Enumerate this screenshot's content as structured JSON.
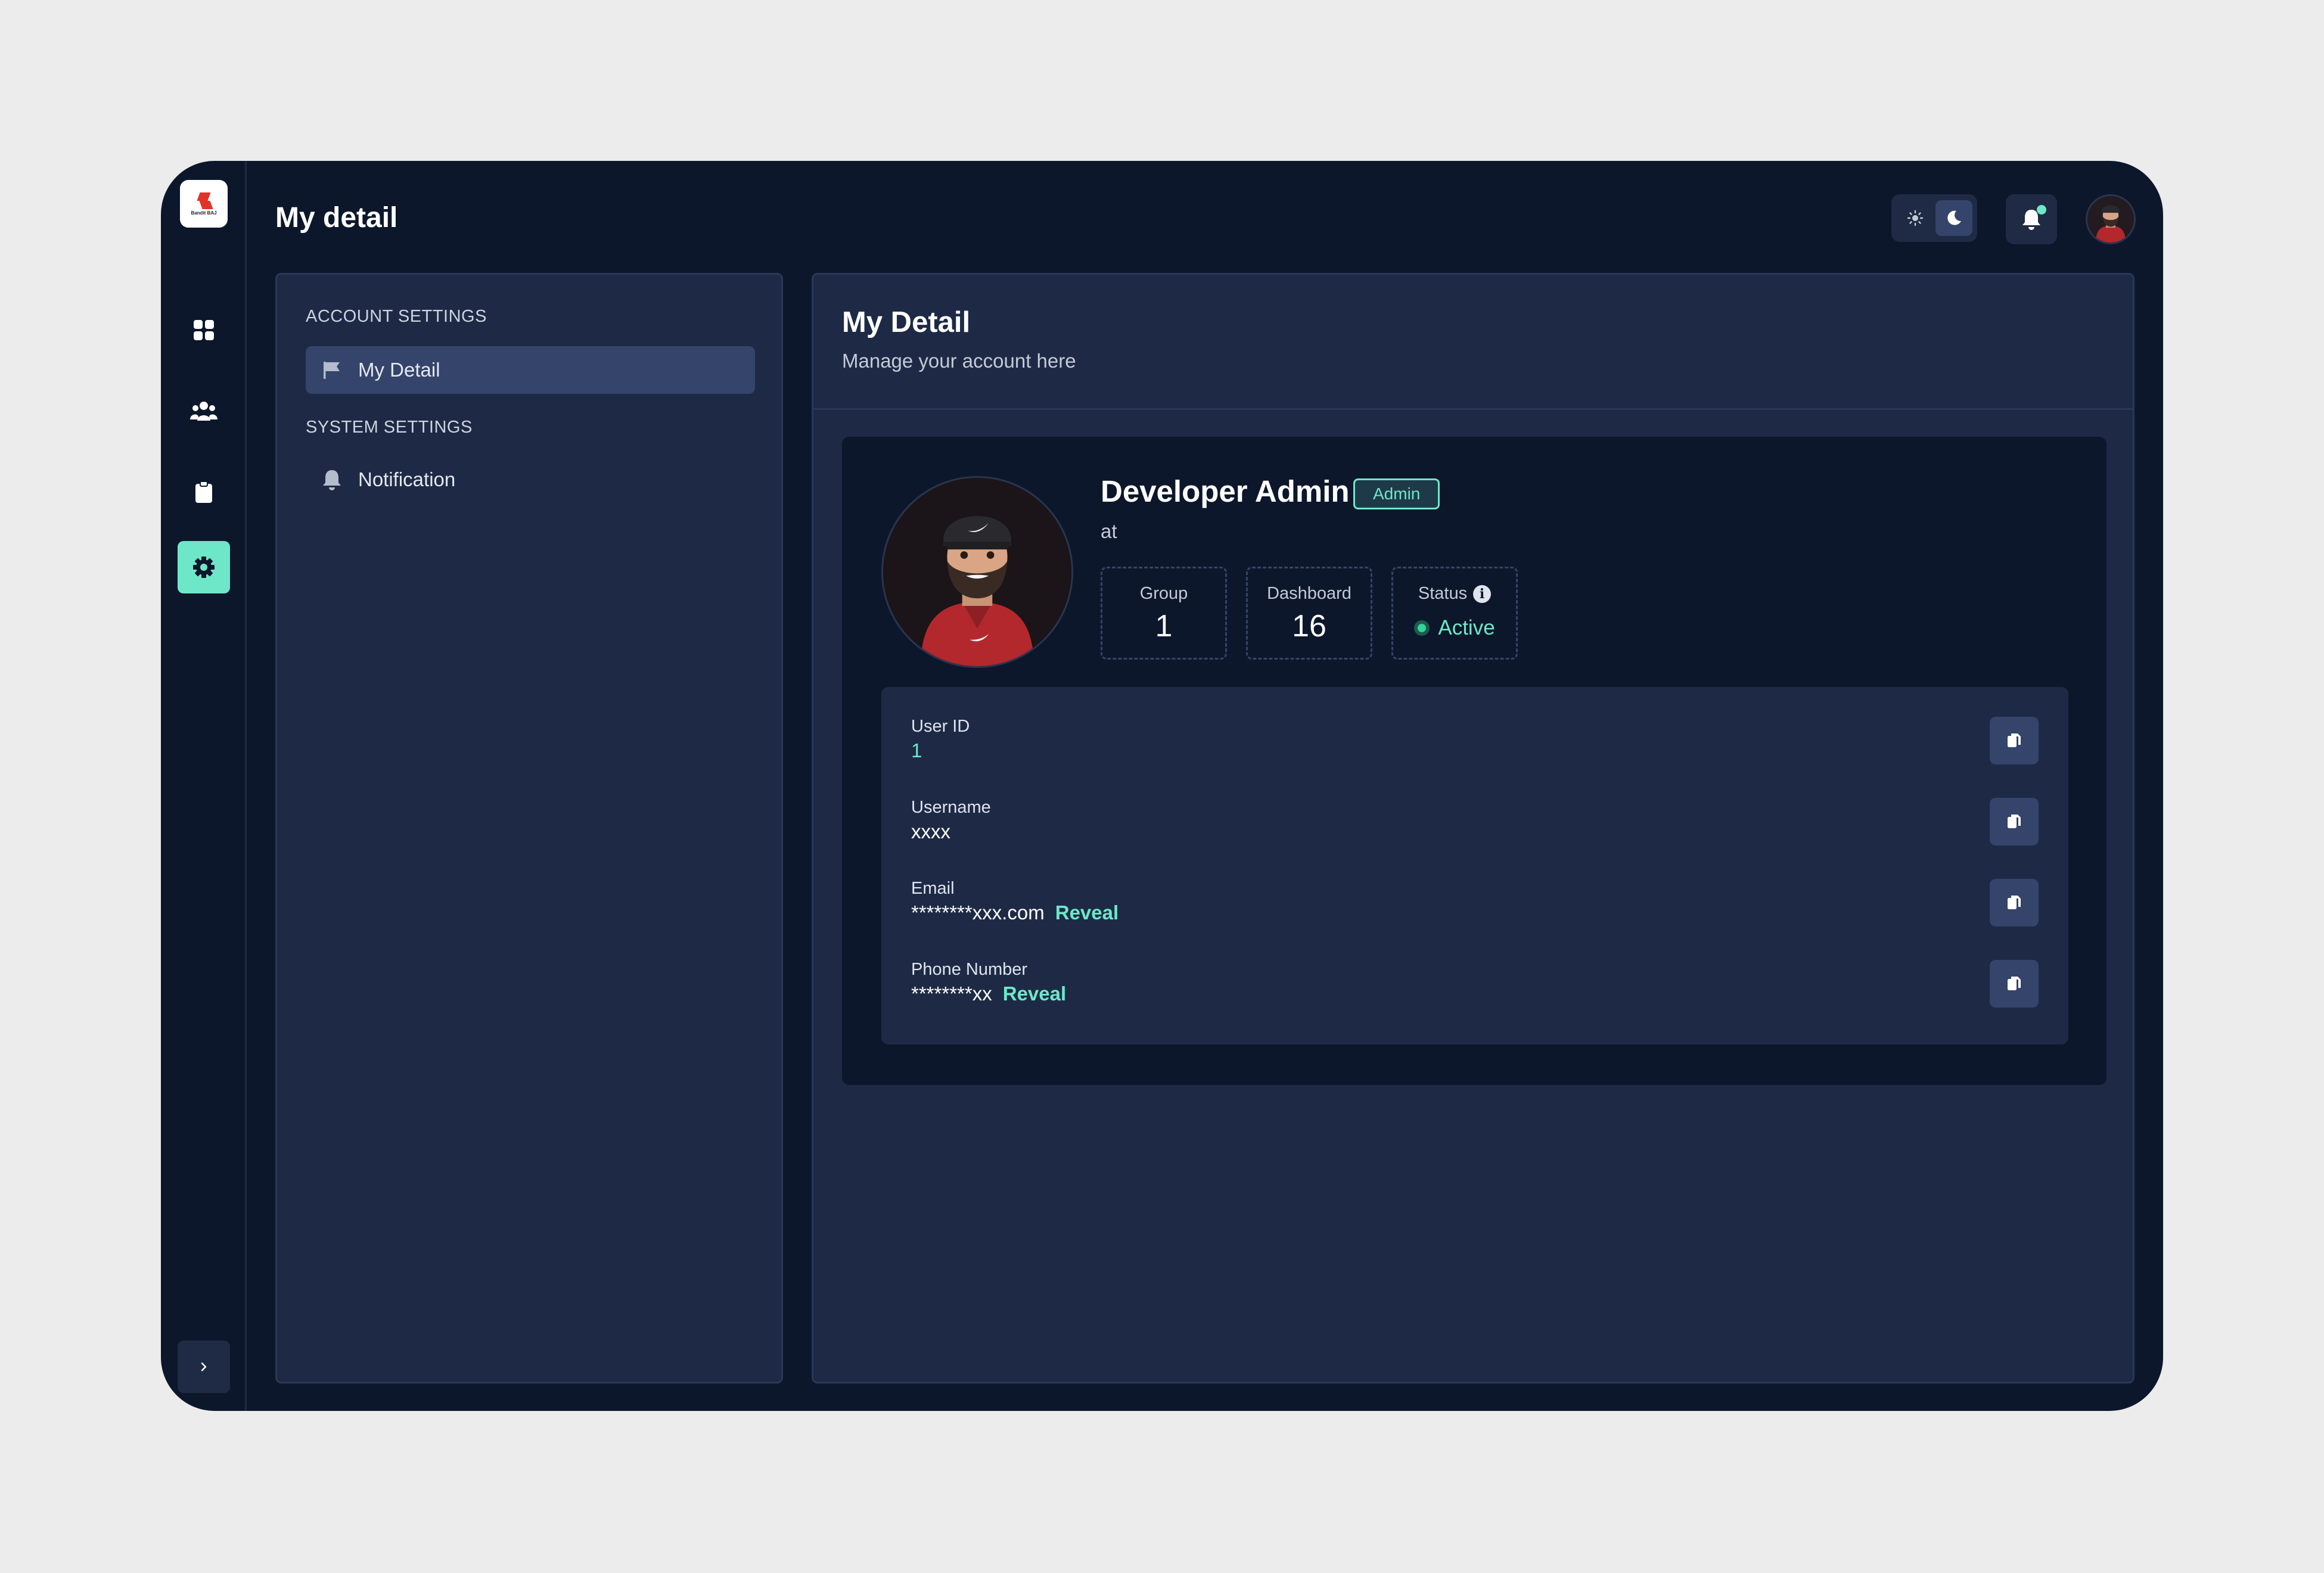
{
  "app": {
    "logo_text": "Bandit BAJ"
  },
  "header": {
    "title": "My detail"
  },
  "sidebar": {
    "items": [
      {
        "name": "dashboard",
        "icon": "grid-icon"
      },
      {
        "name": "users",
        "icon": "users-icon"
      },
      {
        "name": "reports",
        "icon": "clipboard-icon"
      },
      {
        "name": "settings",
        "icon": "gear-icon",
        "active": true
      }
    ]
  },
  "settings_menu": {
    "account_title": "ACCOUNT SETTINGS",
    "account_items": [
      {
        "label": "My Detail",
        "icon": "flag-icon",
        "active": true
      }
    ],
    "system_title": "SYSTEM SETTINGS",
    "system_items": [
      {
        "label": "Notification",
        "icon": "bell-icon"
      }
    ]
  },
  "main": {
    "title": "My Detail",
    "subtitle": "Manage your account here"
  },
  "profile": {
    "name": "Developer Admin",
    "role": "Admin",
    "org": "at",
    "stats": {
      "group_label": "Group",
      "group_value": "1",
      "dashboard_label": "Dashboard",
      "dashboard_value": "16",
      "status_label": "Status",
      "status_value": "Active"
    }
  },
  "fields": {
    "user_id_label": "User ID",
    "user_id_value": "1",
    "username_label": "Username",
    "username_value": "xxxx",
    "email_label": "Email",
    "email_value": "********xxx.com",
    "phone_label": "Phone Number",
    "phone_value": "********xx",
    "reveal_label": "Reveal"
  },
  "colors": {
    "background": "#ececec",
    "app_bg": "#0d172b",
    "panel_bg": "#1e2a45",
    "accent": "#6ee7c9",
    "active_item": "#34446a"
  }
}
